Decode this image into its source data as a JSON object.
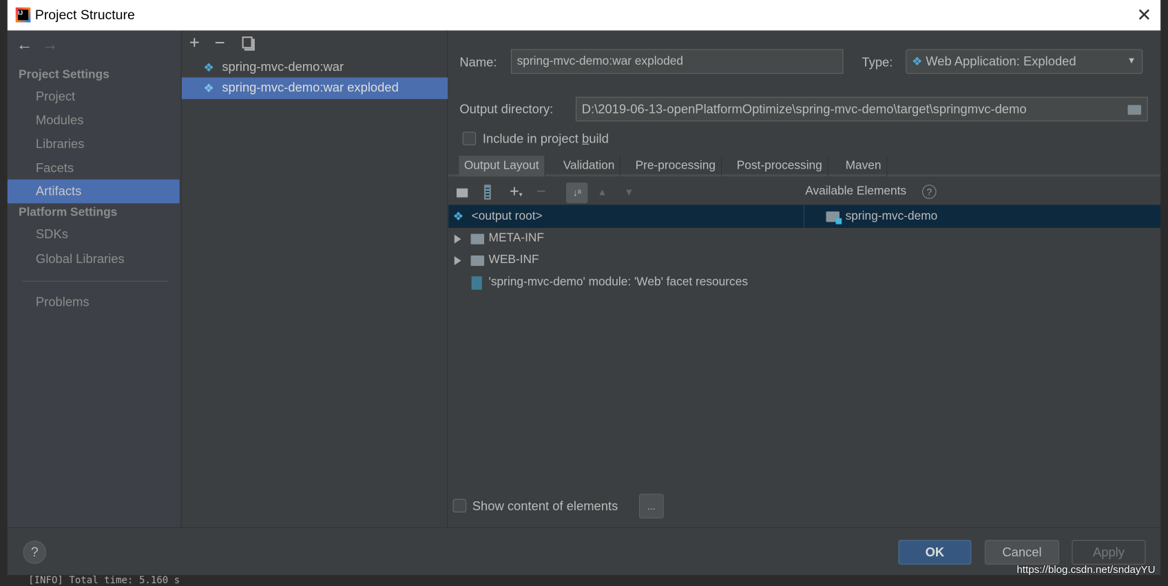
{
  "window": {
    "title": "Project Structure"
  },
  "sidebar": {
    "project_settings_header": "Project Settings",
    "platform_settings_header": "Platform Settings",
    "project_items": [
      {
        "label": "Project"
      },
      {
        "label": "Modules"
      },
      {
        "label": "Libraries"
      },
      {
        "label": "Facets"
      },
      {
        "label": "Artifacts",
        "selected": true
      }
    ],
    "platform_items": [
      {
        "label": "SDKs"
      },
      {
        "label": "Global Libraries"
      }
    ],
    "problems": "Problems"
  },
  "artifacts": {
    "items": [
      {
        "label": "spring-mvc-demo:war"
      },
      {
        "label": "spring-mvc-demo:war exploded",
        "selected": true
      }
    ]
  },
  "form": {
    "name_label": "Name:",
    "name_value": "spring-mvc-demo:war exploded",
    "type_label": "Type:",
    "type_value": "Web Application: Exploded",
    "output_dir_label": "Output directory:",
    "output_dir_value": "D:\\2019-06-13-openPlatformOptimize\\spring-mvc-demo\\target\\springmvc-demo",
    "include_label_pre": "Include in project ",
    "include_label_u": "b",
    "include_label_post": "uild",
    "include_checked": false
  },
  "tabs": [
    {
      "label": "Output Layout",
      "active": true
    },
    {
      "label": "Validation"
    },
    {
      "label": "Pre-processing"
    },
    {
      "label": "Post-processing"
    },
    {
      "label": "Maven"
    }
  ],
  "layout": {
    "available_label": "Available Elements",
    "tree": [
      {
        "label": "<output root>"
      },
      {
        "label": "META-INF"
      },
      {
        "label": "WEB-INF"
      },
      {
        "label": "'spring-mvc-demo' module: 'Web' facet resources"
      }
    ],
    "available": [
      {
        "label": "spring-mvc-demo"
      }
    ]
  },
  "show_content_label": "Show content of elements",
  "show_content_checked": false,
  "ellipsis": "...",
  "buttons": {
    "ok": "OK",
    "cancel": "Cancel",
    "apply": "Apply",
    "help": "?"
  },
  "background": {
    "console": "[INFO] Total time:  5.160 s",
    "watermark": "https://blog.csdn.net/sndayYU"
  },
  "colors": {
    "selection": "#4b6eaf",
    "primary": "#365880",
    "tree_selection": "#0d293e"
  }
}
